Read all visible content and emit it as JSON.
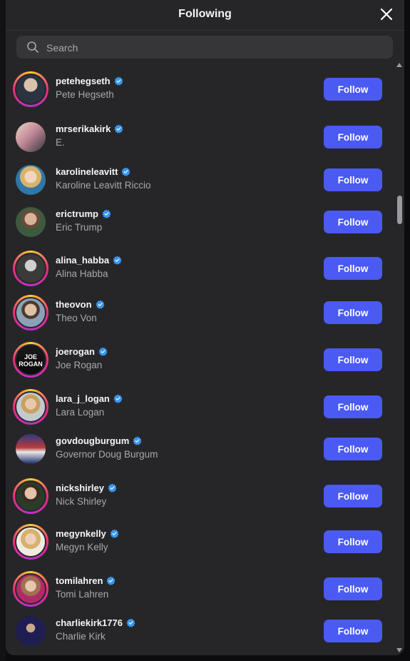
{
  "dialog": {
    "title": "Following",
    "search_placeholder": "Search"
  },
  "follow_label": "Follow",
  "accounts": [
    {
      "username": "petehegseth",
      "name": "Pete Hegseth",
      "verified": true,
      "story_ring": true
    },
    {
      "username": "mrserikakirk",
      "name": "E.",
      "verified": true,
      "story_ring": false
    },
    {
      "username": "karolineleavitt",
      "name": "Karoline Leavitt Riccio",
      "verified": true,
      "story_ring": false
    },
    {
      "username": "erictrump",
      "name": "Eric Trump",
      "verified": true,
      "story_ring": false
    },
    {
      "username": "alina_habba",
      "name": "Alina Habba",
      "verified": true,
      "story_ring": true
    },
    {
      "username": "theovon",
      "name": "Theo Von",
      "verified": true,
      "story_ring": true
    },
    {
      "username": "joerogan",
      "name": "Joe Rogan",
      "verified": true,
      "story_ring": true
    },
    {
      "username": "lara_j_logan",
      "name": "Lara Logan",
      "verified": true,
      "story_ring": true
    },
    {
      "username": "govdougburgum",
      "name": "Governor Doug Burgum",
      "verified": true,
      "story_ring": false
    },
    {
      "username": "nickshirley",
      "name": "Nick Shirley",
      "verified": true,
      "story_ring": true
    },
    {
      "username": "megynkelly",
      "name": "Megyn Kelly",
      "verified": true,
      "story_ring": true
    },
    {
      "username": "tomilahren",
      "name": "Tomi Lahren",
      "verified": true,
      "story_ring": true
    },
    {
      "username": "charliekirk1776",
      "name": "Charlie Kirk",
      "verified": true,
      "story_ring": false
    }
  ],
  "avatar_text": {
    "joerogan": [
      "JOE",
      "ROGAN"
    ]
  },
  "colors": {
    "modal_bg": "#262629",
    "follow_button": "#4a5af3",
    "verified_badge": "#3897f0",
    "secondary_text": "#a8a8ad"
  }
}
